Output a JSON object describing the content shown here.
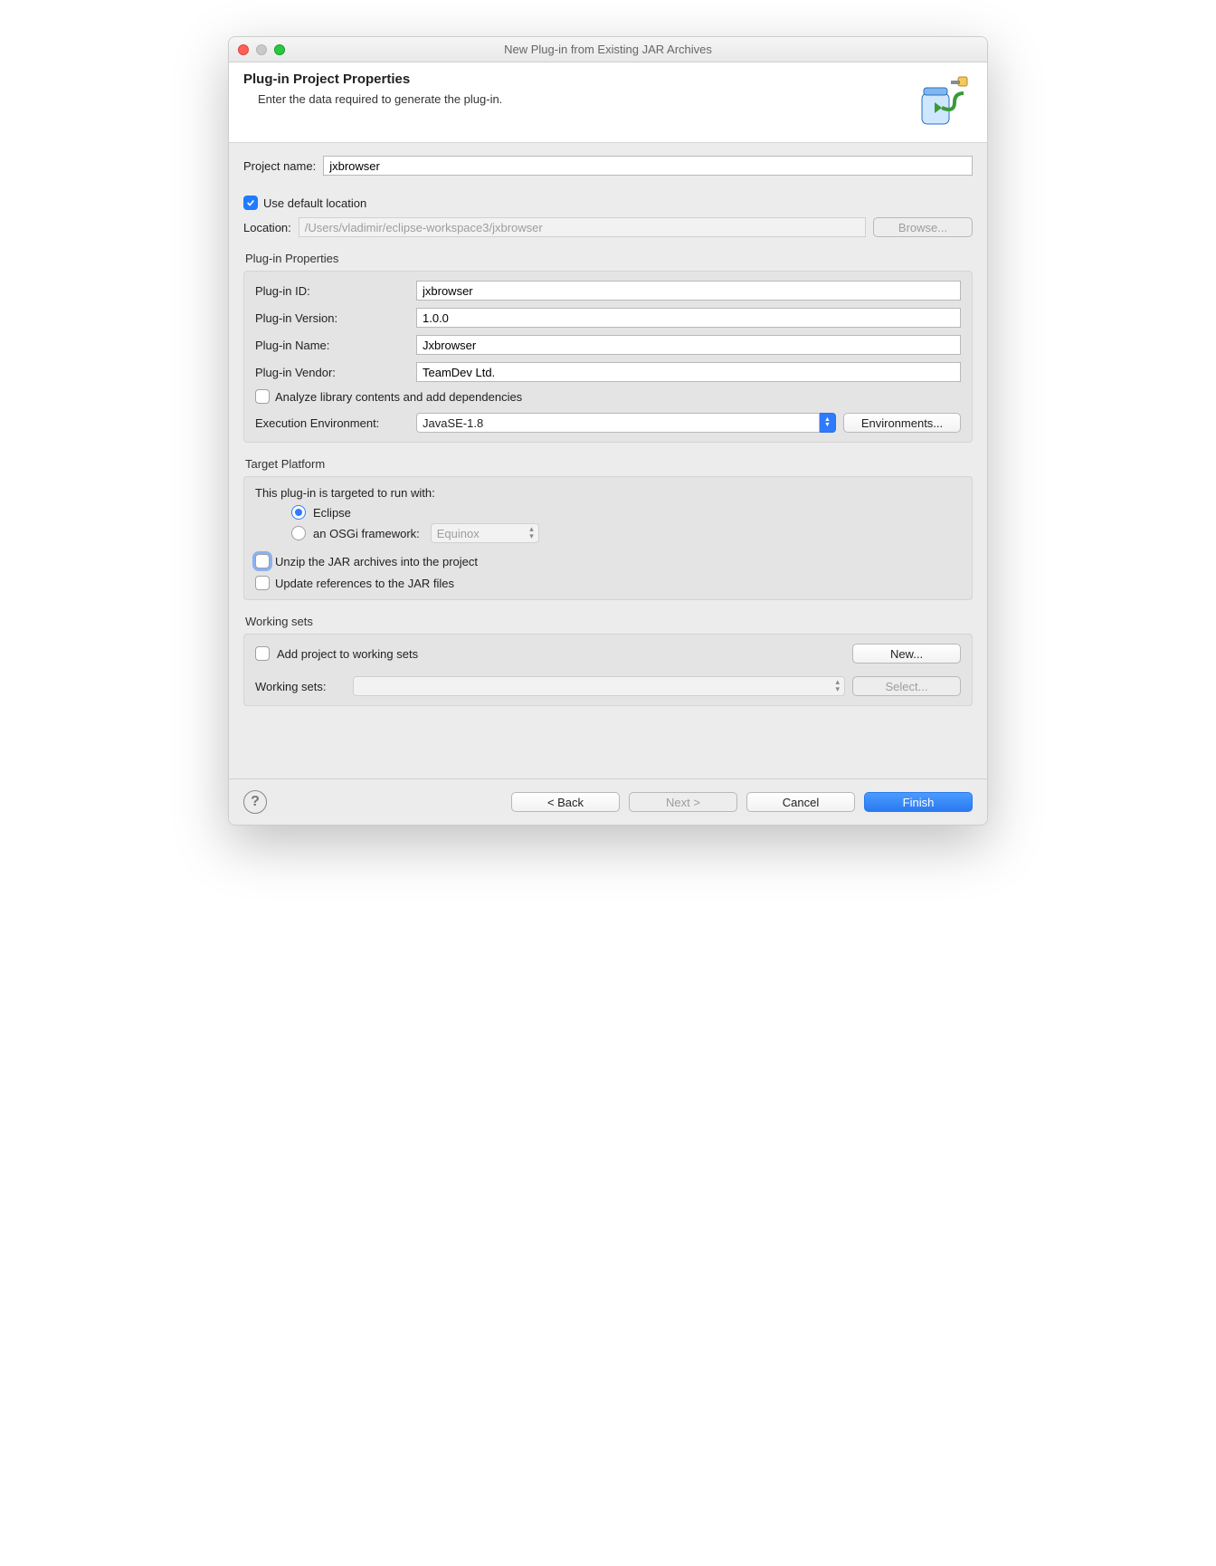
{
  "window": {
    "title": "New Plug-in from Existing JAR Archives"
  },
  "header": {
    "title": "Plug-in Project Properties",
    "subtitle": "Enter the data required to generate the plug-in."
  },
  "project": {
    "name_label": "Project name:",
    "name_value": "jxbrowser",
    "use_default_label": "Use default location",
    "use_default_checked": true,
    "location_label": "Location:",
    "location_value": "/Users/vladimir/eclipse-workspace3/jxbrowser",
    "browse_label": "Browse..."
  },
  "plugin_props": {
    "section_title": "Plug-in Properties",
    "id_label": "Plug-in ID:",
    "id_value": "jxbrowser",
    "version_label": "Plug-in Version:",
    "version_value": "1.0.0",
    "name_label": "Plug-in Name:",
    "name_value": "Jxbrowser",
    "vendor_label": "Plug-in Vendor:",
    "vendor_value": "TeamDev Ltd.",
    "analyze_label": "Analyze library contents and add dependencies",
    "analyze_checked": false,
    "exec_env_label": "Execution Environment:",
    "exec_env_value": "JavaSE-1.8",
    "environments_button": "Environments..."
  },
  "target": {
    "section_title": "Target Platform",
    "intro": "This plug-in is targeted to run with:",
    "eclipse_label": "Eclipse",
    "osgi_label": "an OSGi framework:",
    "osgi_value": "Equinox",
    "selected": "eclipse",
    "unzip_label": "Unzip the JAR archives into the project",
    "unzip_checked": false,
    "update_refs_label": "Update references to the JAR files",
    "update_refs_checked": false
  },
  "working_sets": {
    "section_title": "Working sets",
    "add_label": "Add project to working sets",
    "add_checked": false,
    "new_button": "New...",
    "sets_label": "Working sets:",
    "select_button": "Select..."
  },
  "footer": {
    "back": "< Back",
    "next": "Next >",
    "cancel": "Cancel",
    "finish": "Finish"
  }
}
